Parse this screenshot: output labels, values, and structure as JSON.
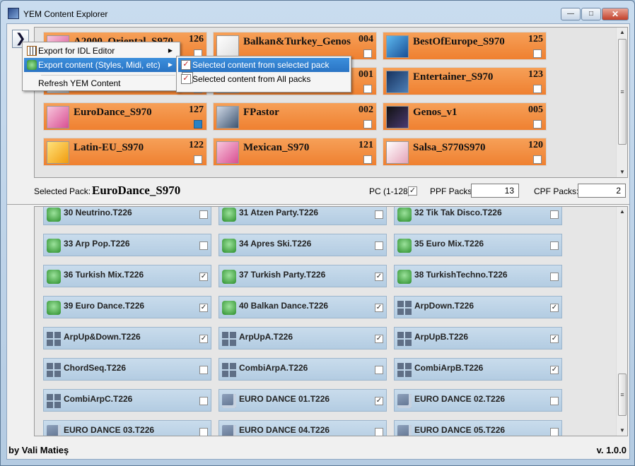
{
  "window": {
    "title": "YEM Content Explorer",
    "min_glyph": "—",
    "max_glyph": "□",
    "close_glyph": "✕",
    "expand_glyph": "❯"
  },
  "packs": [
    {
      "name": "A2000_Oriental_S970",
      "number": "126",
      "checked": false,
      "icon": "pink-pack-icon"
    },
    {
      "name": "Balkan&Turkey_Genos",
      "number": "004",
      "checked": false,
      "icon": "lock-pack-icon"
    },
    {
      "name": "BestOfEurope_S970",
      "number": "125",
      "checked": false,
      "icon": "blue-pack-icon"
    },
    {
      "name": "",
      "number": "",
      "checked": false,
      "icon": "pack-icon"
    },
    {
      "name": "",
      "number": "001",
      "checked": false,
      "icon": "pack-icon"
    },
    {
      "name": "Entertainer_S970",
      "number": "123",
      "checked": false,
      "icon": "entertainer-pack-icon"
    },
    {
      "name": "EuroDance_S970",
      "number": "127",
      "checked": true,
      "icon": "pink-pack-icon"
    },
    {
      "name": "FPastor",
      "number": "002",
      "checked": false,
      "icon": "photo-pack-icon"
    },
    {
      "name": "Genos_v1",
      "number": "005",
      "checked": false,
      "icon": "genos-pack-icon"
    },
    {
      "name": "Latin-EU_S970",
      "number": "122",
      "checked": false,
      "icon": "yellow-pack-icon"
    },
    {
      "name": "Mexican_S970",
      "number": "121",
      "checked": false,
      "icon": "pink-pack-icon"
    },
    {
      "name": "Salsa_S770S970",
      "number": "120",
      "checked": false,
      "icon": "white-pack-icon"
    }
  ],
  "info": {
    "selected_label": "Selected Pack:",
    "selected_value": "EuroDance_S970",
    "pc_label": "PC (1-128)",
    "pc_checked": true,
    "ppf_label": "PPF Packs:",
    "ppf_value": "13",
    "cpf_label": "CPF Packs:",
    "cpf_value": "2"
  },
  "styles": [
    {
      "name": "30 Neutrino.T226",
      "checked": false,
      "icon": "drum-icon"
    },
    {
      "name": "31 Atzen Party.T226",
      "checked": false,
      "icon": "drum-icon"
    },
    {
      "name": "32 Tik Tak Disco.T226",
      "checked": false,
      "icon": "drum-icon"
    },
    {
      "name": "33 Arp Pop.T226",
      "checked": false,
      "icon": "drum-icon"
    },
    {
      "name": "34 Apres Ski.T226",
      "checked": false,
      "icon": "drum-icon"
    },
    {
      "name": "35 Euro Mix.T226",
      "checked": false,
      "icon": "drum-icon"
    },
    {
      "name": "36 Turkish Mix.T226",
      "checked": true,
      "icon": "drum-icon"
    },
    {
      "name": "37 Turkish Party.T226",
      "checked": true,
      "icon": "drum-icon"
    },
    {
      "name": "38 TurkishTechno.T226",
      "checked": false,
      "icon": "drum-icon"
    },
    {
      "name": "39 Euro Dance.T226",
      "checked": true,
      "icon": "drum-icon"
    },
    {
      "name": "40 Balkan Dance.T226",
      "checked": true,
      "icon": "drum-icon"
    },
    {
      "name": "ArpDown.T226",
      "checked": true,
      "icon": "grid-icon"
    },
    {
      "name": "ArpUp&Down.T226",
      "checked": true,
      "icon": "grid-icon"
    },
    {
      "name": "ArpUpA.T226",
      "checked": true,
      "icon": "grid-icon"
    },
    {
      "name": "ArpUpB.T226",
      "checked": true,
      "icon": "grid-icon"
    },
    {
      "name": "ChordSeq.T226",
      "checked": false,
      "icon": "grid-icon"
    },
    {
      "name": "CombiArpA.T226",
      "checked": false,
      "icon": "grid-icon"
    },
    {
      "name": "CombiArpB.T226",
      "checked": true,
      "icon": "grid-icon"
    },
    {
      "name": "CombiArpC.T226",
      "checked": false,
      "icon": "grid-icon"
    },
    {
      "name": "EURO DANCE 01.T226",
      "checked": true,
      "icon": "file-icon"
    },
    {
      "name": "EURO DANCE 02.T226",
      "checked": false,
      "icon": "file-icon"
    },
    {
      "name": "EURO DANCE 03.T226",
      "checked": false,
      "icon": "file-icon"
    },
    {
      "name": "EURO DANCE 04.T226",
      "checked": false,
      "icon": "file-icon"
    },
    {
      "name": "EURO DANCE 05.T226",
      "checked": false,
      "icon": "file-icon"
    }
  ],
  "menu": {
    "items": [
      {
        "label": "Export for IDL Editor",
        "icon": "keyboard-icon",
        "has_submenu": true
      },
      {
        "label": "Export content (Styles, Midi, etc)",
        "icon": "export-icon",
        "has_submenu": true
      },
      {
        "label": "Refresh YEM Content",
        "icon": "",
        "has_submenu": false
      }
    ],
    "submenu": [
      {
        "label": "Selected content from selected pack",
        "icon": "checked-box-icon"
      },
      {
        "label": "Selected content from All packs",
        "icon": "multi-check-icon"
      }
    ],
    "arrow_glyph": "▶"
  },
  "footer": {
    "author": "by Vali Matieș",
    "version": "v. 1.0.0"
  },
  "colors": {
    "pack_orange": "#ef8030",
    "style_blue": "#b3cce2",
    "menu_highlight": "#2a74c4",
    "window_frame": "#b4cbe2"
  },
  "scrollbar_glyphs": {
    "up": "▲",
    "down": "▼",
    "grip": "≡"
  }
}
